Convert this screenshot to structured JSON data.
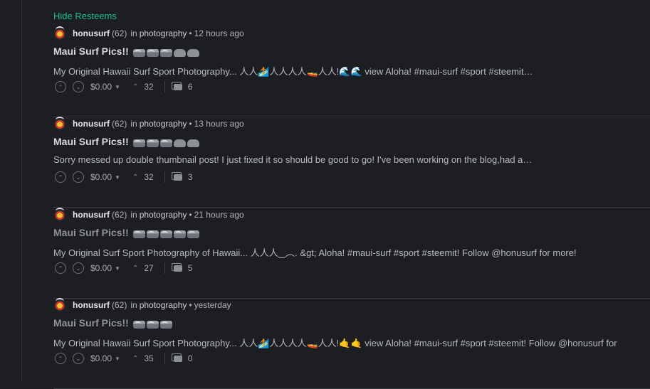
{
  "hide_resteems": "Hide Resteems",
  "posts": [
    {
      "author": "honusurf",
      "rep": "(62)",
      "in": "in",
      "category": "photography",
      "time": "12 hours ago",
      "title": "Maui Surf Pics!!",
      "title_icons": [
        "wave-icon",
        "wave-icon",
        "wave-icon",
        "shaka-icon",
        "shaka-icon"
      ],
      "excerpt": "My Original Hawaii Surf Sport Photography... 人人🏄人人人人🚤人人!🌊🌊 view Aloha! #maui-surf #sport #steemit…",
      "payout": "$0.00",
      "votes": "32",
      "comments": "6"
    },
    {
      "author": "honusurf",
      "rep": "(62)",
      "in": "in",
      "category": "photography",
      "time": "13 hours ago",
      "title": "Maui Surf Pics!!",
      "title_icons": [
        "wave-icon",
        "wave-icon",
        "wave-icon",
        "shaka-icon",
        "shaka-icon"
      ],
      "excerpt": "Sorry messed up double thumbnail post! I just fixed it so should be good to go! I've been working on the blog,had a…",
      "payout": "$0.00",
      "votes": "32",
      "comments": "3"
    },
    {
      "author": "honusurf",
      "rep": "(62)",
      "in": "in",
      "category": "photography",
      "time": "21 hours ago",
      "title": "Maui Surf Pics!!",
      "title_icons": [
        "wave-icon",
        "wave-icon",
        "wave-icon",
        "wave-icon",
        "wave-icon"
      ],
      "excerpt": "My Original Surf Sport Photography of Hawaii... 人人人‿︵. &gt; Aloha! #maui-surf #sport #steemit! Follow @honusurf for more!",
      "payout": "$0.00",
      "votes": "27",
      "comments": "5"
    },
    {
      "author": "honusurf",
      "rep": "(62)",
      "in": "in",
      "category": "photography",
      "time": "yesterday",
      "title": "Maui Surf Pics!!",
      "title_icons": [
        "wave-icon",
        "wave-icon",
        "wave-icon"
      ],
      "excerpt": "My Original Hawaii Surf Sport Photography... 人人🏄人人人人🚤人人!🤙🤙 view Aloha! #maui-surf #sport #steemit! Follow @honusurf for",
      "payout": "$0.00",
      "votes": "35",
      "comments": "0"
    }
  ],
  "colors": {
    "background": "#1c1e22",
    "accent": "#1fbf8f"
  }
}
